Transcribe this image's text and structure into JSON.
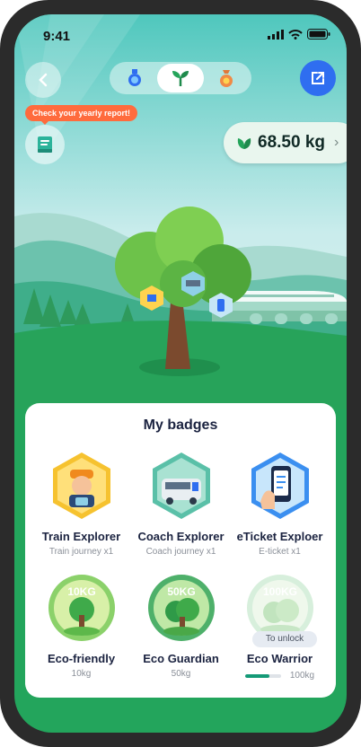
{
  "status_bar": {
    "time": "9:41"
  },
  "tabs": [
    {
      "icon": "medal-icon",
      "active": false
    },
    {
      "icon": "sprout-icon",
      "active": true
    },
    {
      "icon": "money-bag-icon",
      "active": false
    }
  ],
  "report": {
    "label": "Check your yearly report!"
  },
  "carbon": {
    "value": "68.50 kg"
  },
  "badges": {
    "title": "My badges",
    "items": [
      {
        "name": "Train Explorer",
        "sub": "Train journey x1",
        "icon": "train-explorer-badge-icon"
      },
      {
        "name": "Coach Explorer",
        "sub": "Coach journey x1",
        "icon": "coach-explorer-badge-icon"
      },
      {
        "name": "eTicket Exploer",
        "sub": "E-ticket x1",
        "icon": "eticket-explorer-badge-icon"
      },
      {
        "name": "Eco-friendly",
        "sub": "10kg",
        "icon": "eco-friendly-badge-icon",
        "badge_text": "10KG"
      },
      {
        "name": "Eco Guardian",
        "sub": "50kg",
        "icon": "eco-guardian-badge-icon",
        "badge_text": "50KG"
      },
      {
        "name": "Eco Warrior",
        "sub": "100kg",
        "icon": "eco-warrior-badge-icon",
        "badge_text": "100KG",
        "locked_label": "To unlock",
        "progress": 0.68
      }
    ]
  },
  "colors": {
    "accent": "#2f6ef0",
    "green": "#23a55c",
    "tip": "#ff6b3d",
    "progress": "#149a77"
  }
}
